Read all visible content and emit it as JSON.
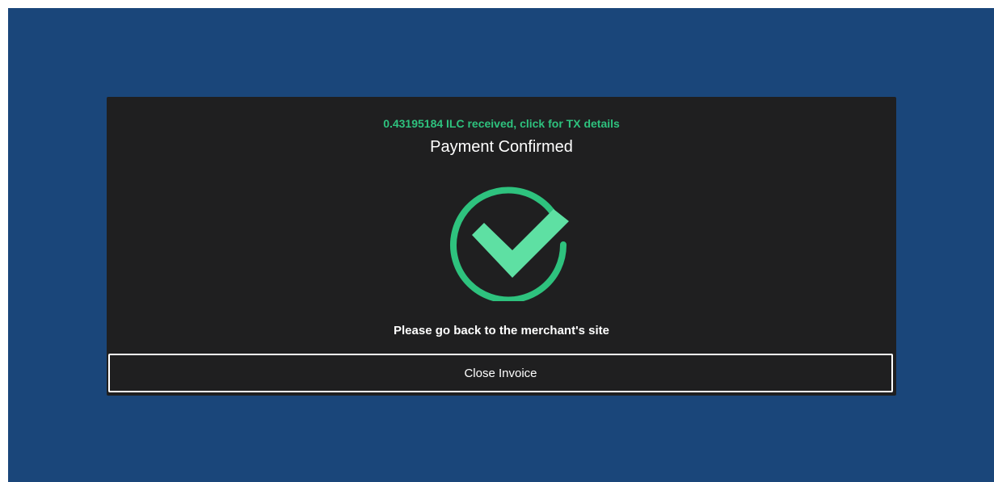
{
  "invoice": {
    "tx_link_text": "0.43195184 ILC received, click for TX details",
    "title": "Payment Confirmed",
    "message": "Please go back to the merchant's site",
    "close_button_label": "Close Invoice",
    "status_icon": "checkmark-circle-icon"
  },
  "colors": {
    "page_background": "#1a467a",
    "card_background": "#1f1f20",
    "accent_green": "#2ec27e",
    "check_green": "#5ee0a3",
    "text_white": "#ffffff"
  }
}
